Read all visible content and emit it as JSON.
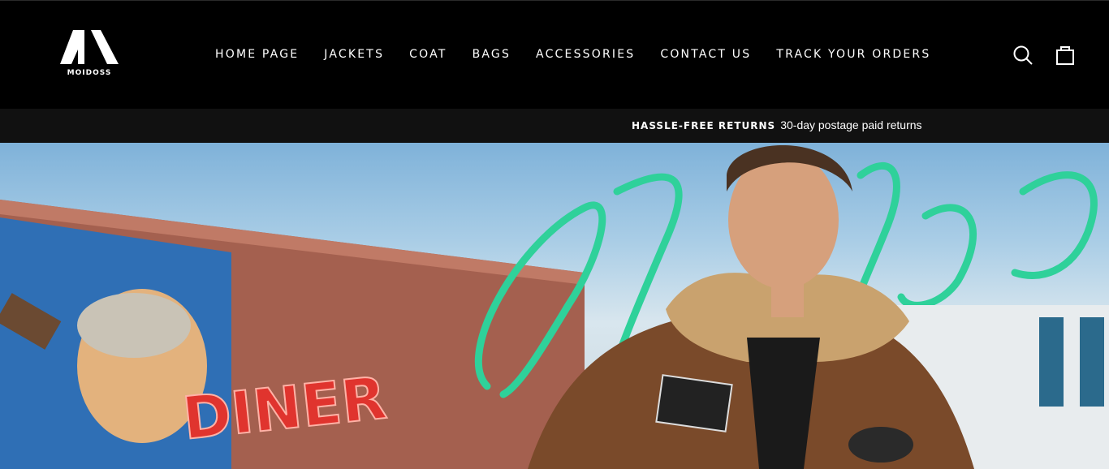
{
  "brand": {
    "name": "MOIDOSS"
  },
  "nav": {
    "items": [
      {
        "label": "HOME PAGE"
      },
      {
        "label": "JACKETS"
      },
      {
        "label": "COAT"
      },
      {
        "label": "BAGS"
      },
      {
        "label": "ACCESSORIES"
      },
      {
        "label": "CONTACT US"
      },
      {
        "label": "TRACK YOUR ORDERS"
      }
    ]
  },
  "header_icons": {
    "search": "search-icon",
    "cart": "shopping-bag-icon"
  },
  "announcement": {
    "bold": "HASSLE-FREE RETURNS",
    "text": "30-day postage paid returns"
  },
  "hero": {
    "sign_text": "DINER",
    "colors": {
      "neon_green": "#2fd19a",
      "neon_red": "#e0342e",
      "jacket": "#7a4a2a"
    }
  }
}
